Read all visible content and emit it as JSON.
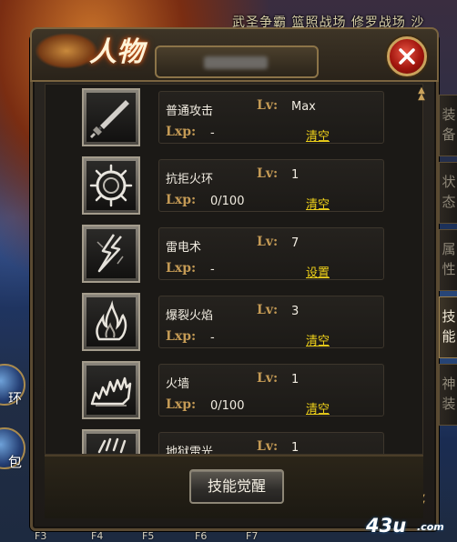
{
  "window": {
    "title_glyph": "人物",
    "close_icon": "close-x-icon"
  },
  "background": {
    "banner_text": "武圣争霸 篮照战场 修罗战场 沙",
    "left_badges": [
      "环",
      "包"
    ]
  },
  "fkeys": [
    "F3",
    "F4",
    "F5",
    "F6",
    "F7"
  ],
  "skills": [
    {
      "name": "普通攻击",
      "lv_label": "Lv:",
      "lv": "Max",
      "lxp_label": "Lxp:",
      "lxp": "-",
      "action": "清空",
      "icon": "sword-icon"
    },
    {
      "name": "抗拒火环",
      "lv_label": "Lv:",
      "lv": "1",
      "lxp_label": "Lxp:",
      "lxp": "0/100",
      "action": "清空",
      "icon": "fire-ring-icon"
    },
    {
      "name": "雷电术",
      "lv_label": "Lv:",
      "lv": "7",
      "lxp_label": "Lxp:",
      "lxp": "-",
      "action": "设置",
      "icon": "lightning-icon"
    },
    {
      "name": "爆裂火焰",
      "lv_label": "Lv:",
      "lv": "3",
      "lxp_label": "Lxp:",
      "lxp": "-",
      "action": "清空",
      "icon": "flame-burst-icon"
    },
    {
      "name": "火墙",
      "lv_label": "Lv:",
      "lv": "1",
      "lxp_label": "Lxp:",
      "lxp": "0/100",
      "action": "清空",
      "icon": "fire-wall-icon"
    },
    {
      "name": "地狱雷光",
      "lv_label": "Lv:",
      "lv": "1",
      "lxp_label": "Lxp:",
      "lxp": "",
      "action": "",
      "icon": "hell-thunder-icon"
    }
  ],
  "bottom": {
    "awaken_button": "技能觉醒"
  },
  "side_tabs": [
    {
      "label": "装备",
      "active": false
    },
    {
      "label": "状态",
      "active": false
    },
    {
      "label": "属性",
      "active": false
    },
    {
      "label": "技能",
      "active": true
    },
    {
      "label": "神装",
      "active": false
    }
  ],
  "watermark": {
    "number": "43u",
    "domain": ".com"
  },
  "colors": {
    "gold_label": "#c49a55",
    "link_yellow": "#f0d21a",
    "close_red": "#c4261a"
  }
}
